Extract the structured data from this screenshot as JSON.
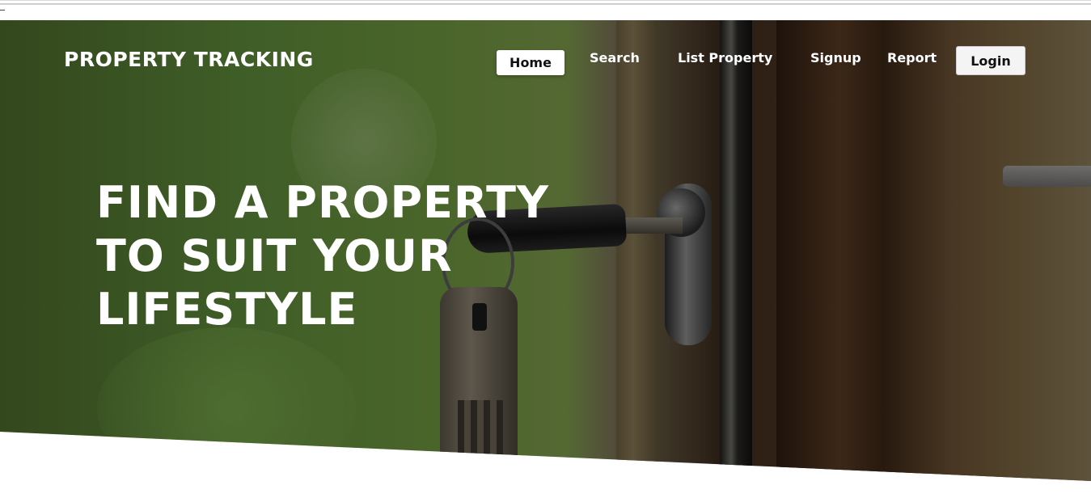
{
  "brand": {
    "name": "PROPERTY TRACKING"
  },
  "nav": {
    "home": "Home",
    "search": "Search",
    "list_property": "List Property",
    "signup": "Signup",
    "report": "Report",
    "login": "Login",
    "active": "Home"
  },
  "hero": {
    "headline_lines": [
      "FIND A PROPERTY",
      "TO SUIT YOUR",
      "LIFESTYLE"
    ],
    "image": "key-in-door-lock"
  },
  "colors": {
    "text": "#ffffff",
    "active_bg": "#ffffff",
    "active_text": "#111111"
  }
}
